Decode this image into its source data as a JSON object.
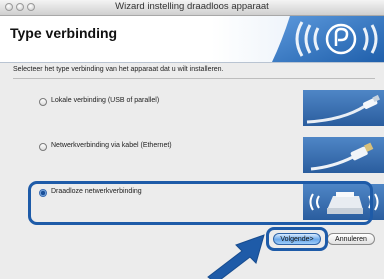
{
  "window": {
    "title": "Wizard instelling draadloos apparaat"
  },
  "header": {
    "title": "Type verbinding"
  },
  "instruction": "Selecteer het type verbinding van het apparaat dat u wilt installeren.",
  "options": [
    {
      "label": "Lokale verbinding (USB of parallel)",
      "selected": false,
      "icon": "usb-cable-icon"
    },
    {
      "label": "Netwerkverbinding via kabel (Ethernet)",
      "selected": false,
      "icon": "ethernet-cable-icon"
    },
    {
      "label": "Draadloze netwerkverbinding",
      "selected": true,
      "icon": "wireless-printer-icon"
    }
  ],
  "buttons": {
    "next": "Volgende>",
    "cancel": "Annuleren"
  },
  "colors": {
    "accent": "#1e5ba8",
    "banner": "#2f72c4"
  }
}
